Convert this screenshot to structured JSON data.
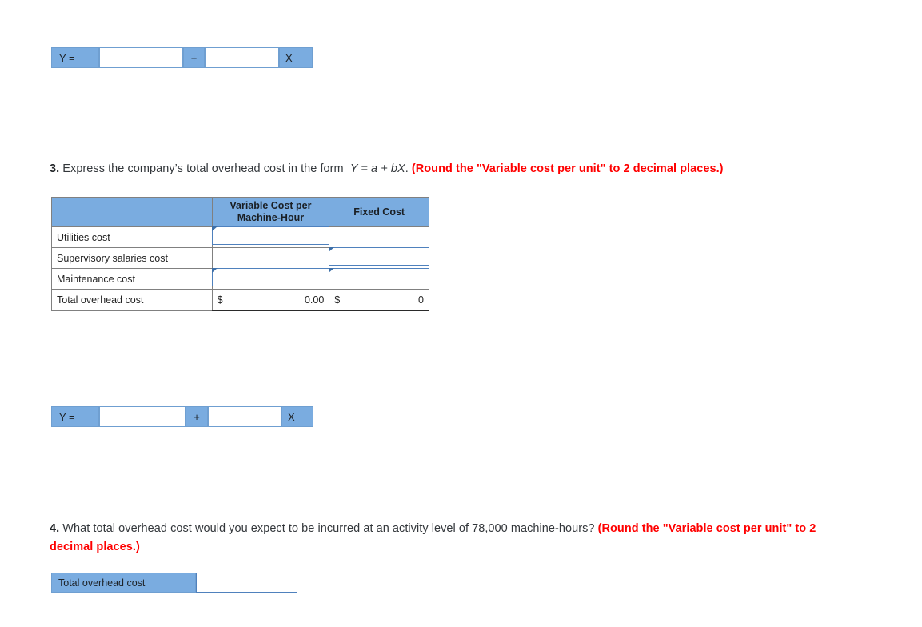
{
  "equation_row_1": {
    "label": "Y =",
    "a_value": "",
    "operator": "+",
    "b_value": "",
    "x_label": "X"
  },
  "question_3": {
    "number": "3.",
    "text_before": "Express the company",
    "text_apostrophe": "’s total overhead cost in the form ",
    "formula": "Y = a + bX",
    "period": ".",
    "instruction": "(Round the \"Variable cost per unit\" to 2 decimal places.)",
    "formula_parts": {
      "y": "Y",
      "eq": " = ",
      "a": "a",
      "plus": " + ",
      "b": "b",
      "x": "X"
    }
  },
  "cost_table": {
    "columns": [
      "",
      "Variable Cost per Machine-Hour",
      "Fixed Cost"
    ],
    "column_header_variable": "Variable Cost per Machine-Hour",
    "column_header_variable_line1": "Variable Cost per",
    "column_header_variable_line2": "Machine-Hour",
    "column_header_fixed": "Fixed Cost",
    "rows": [
      {
        "label": "Utilities cost",
        "variable_value": "",
        "variable_active": true,
        "fixed_value": "",
        "fixed_active": false
      },
      {
        "label": "Supervisory salaries cost",
        "variable_value": "",
        "variable_active": false,
        "fixed_value": "",
        "fixed_active": true
      },
      {
        "label": "Maintenance cost",
        "variable_value": "",
        "variable_active": true,
        "fixed_value": "",
        "fixed_active": true
      }
    ],
    "total_row": {
      "label": "Total overhead cost",
      "variable_currency": "$",
      "variable_total": "0.00",
      "fixed_currency": "$",
      "fixed_total": "0"
    }
  },
  "equation_row_2": {
    "label": "Y =",
    "a_value": "",
    "operator": "+",
    "b_value": "",
    "x_label": "X"
  },
  "question_4": {
    "number": "4.",
    "text": "What total overhead cost would you expect to be incurred at an activity level of 78,000 machine-hours?",
    "activity_level": "78,000",
    "instruction_line1": "(Round the \"Variable cost",
    "instruction_line2": "per unit\" to 2 decimal places.)"
  },
  "total_overhead_answer": {
    "label": "Total overhead cost",
    "value": ""
  },
  "colors": {
    "header_blue": "#7aace0",
    "entry_border_blue": "#4f81bd",
    "flag_blue": "#3d6fa8",
    "instruction_red": "#ff0000",
    "table_border": "#808080",
    "text": "#33373b"
  }
}
